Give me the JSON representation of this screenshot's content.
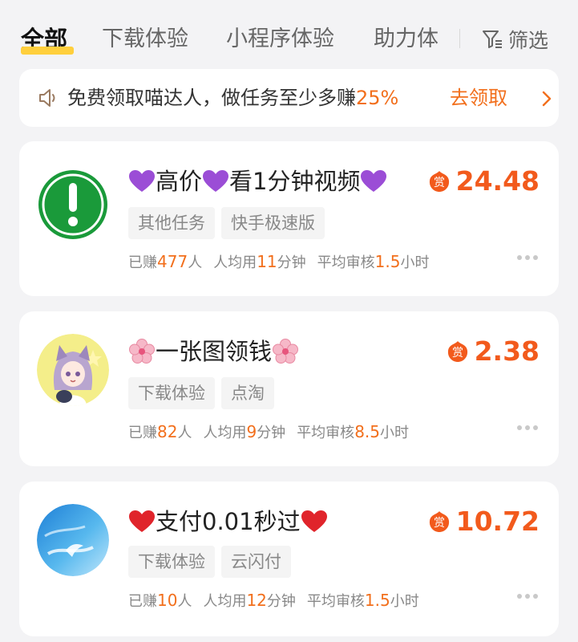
{
  "tabs": [
    {
      "label": "全部",
      "active": true
    },
    {
      "label": "下载体验",
      "active": false
    },
    {
      "label": "小程序体验",
      "active": false
    },
    {
      "label": "助力体",
      "active": false
    }
  ],
  "filter": {
    "label": "筛选",
    "icon": "filter-icon"
  },
  "notice": {
    "icon": "speaker-icon",
    "text": "免费领取喵达人，做任务至少多赚",
    "percent": "25%",
    "action": "去领取",
    "action_icon": "chevron-right-icon"
  },
  "colors": {
    "accent": "#f26f1c",
    "reward": "#f25a1c",
    "tab_underline": "#ffcf3c"
  },
  "reward_icon_label": "赏",
  "stats_labels": {
    "earned_prefix": "已赚",
    "earned_suffix": "人",
    "avg_prefix": "人均用",
    "avg_suffix": "分钟",
    "review_prefix": "平均审核",
    "review_suffix": "小时"
  },
  "tasks": [
    {
      "avatar": "exclamation-icon",
      "title_text": "高价",
      "title_text2": "看1分钟视频",
      "title_emoji": "purple-heart-icon",
      "reward": "24.48",
      "tags": [
        "其他任务",
        "快手极速版"
      ],
      "earned": "477",
      "avg_minutes": "11",
      "review_hours": "1.5"
    },
    {
      "avatar": "anime-cat-girl-avatar",
      "title_text": "一张图领钱",
      "title_emoji": "cherry-blossom-icon",
      "reward": "2.38",
      "tags": [
        "下载体验",
        "点淘"
      ],
      "earned": "82",
      "avg_minutes": "9",
      "review_hours": "8.5"
    },
    {
      "avatar": "blue-sky-avatar",
      "title_text": "支付0.01秒过",
      "title_emoji": "red-heart-icon",
      "reward": "10.72",
      "tags": [
        "下载体验",
        "云闪付"
      ],
      "earned": "10",
      "avg_minutes": "12",
      "review_hours": "1.5"
    }
  ]
}
